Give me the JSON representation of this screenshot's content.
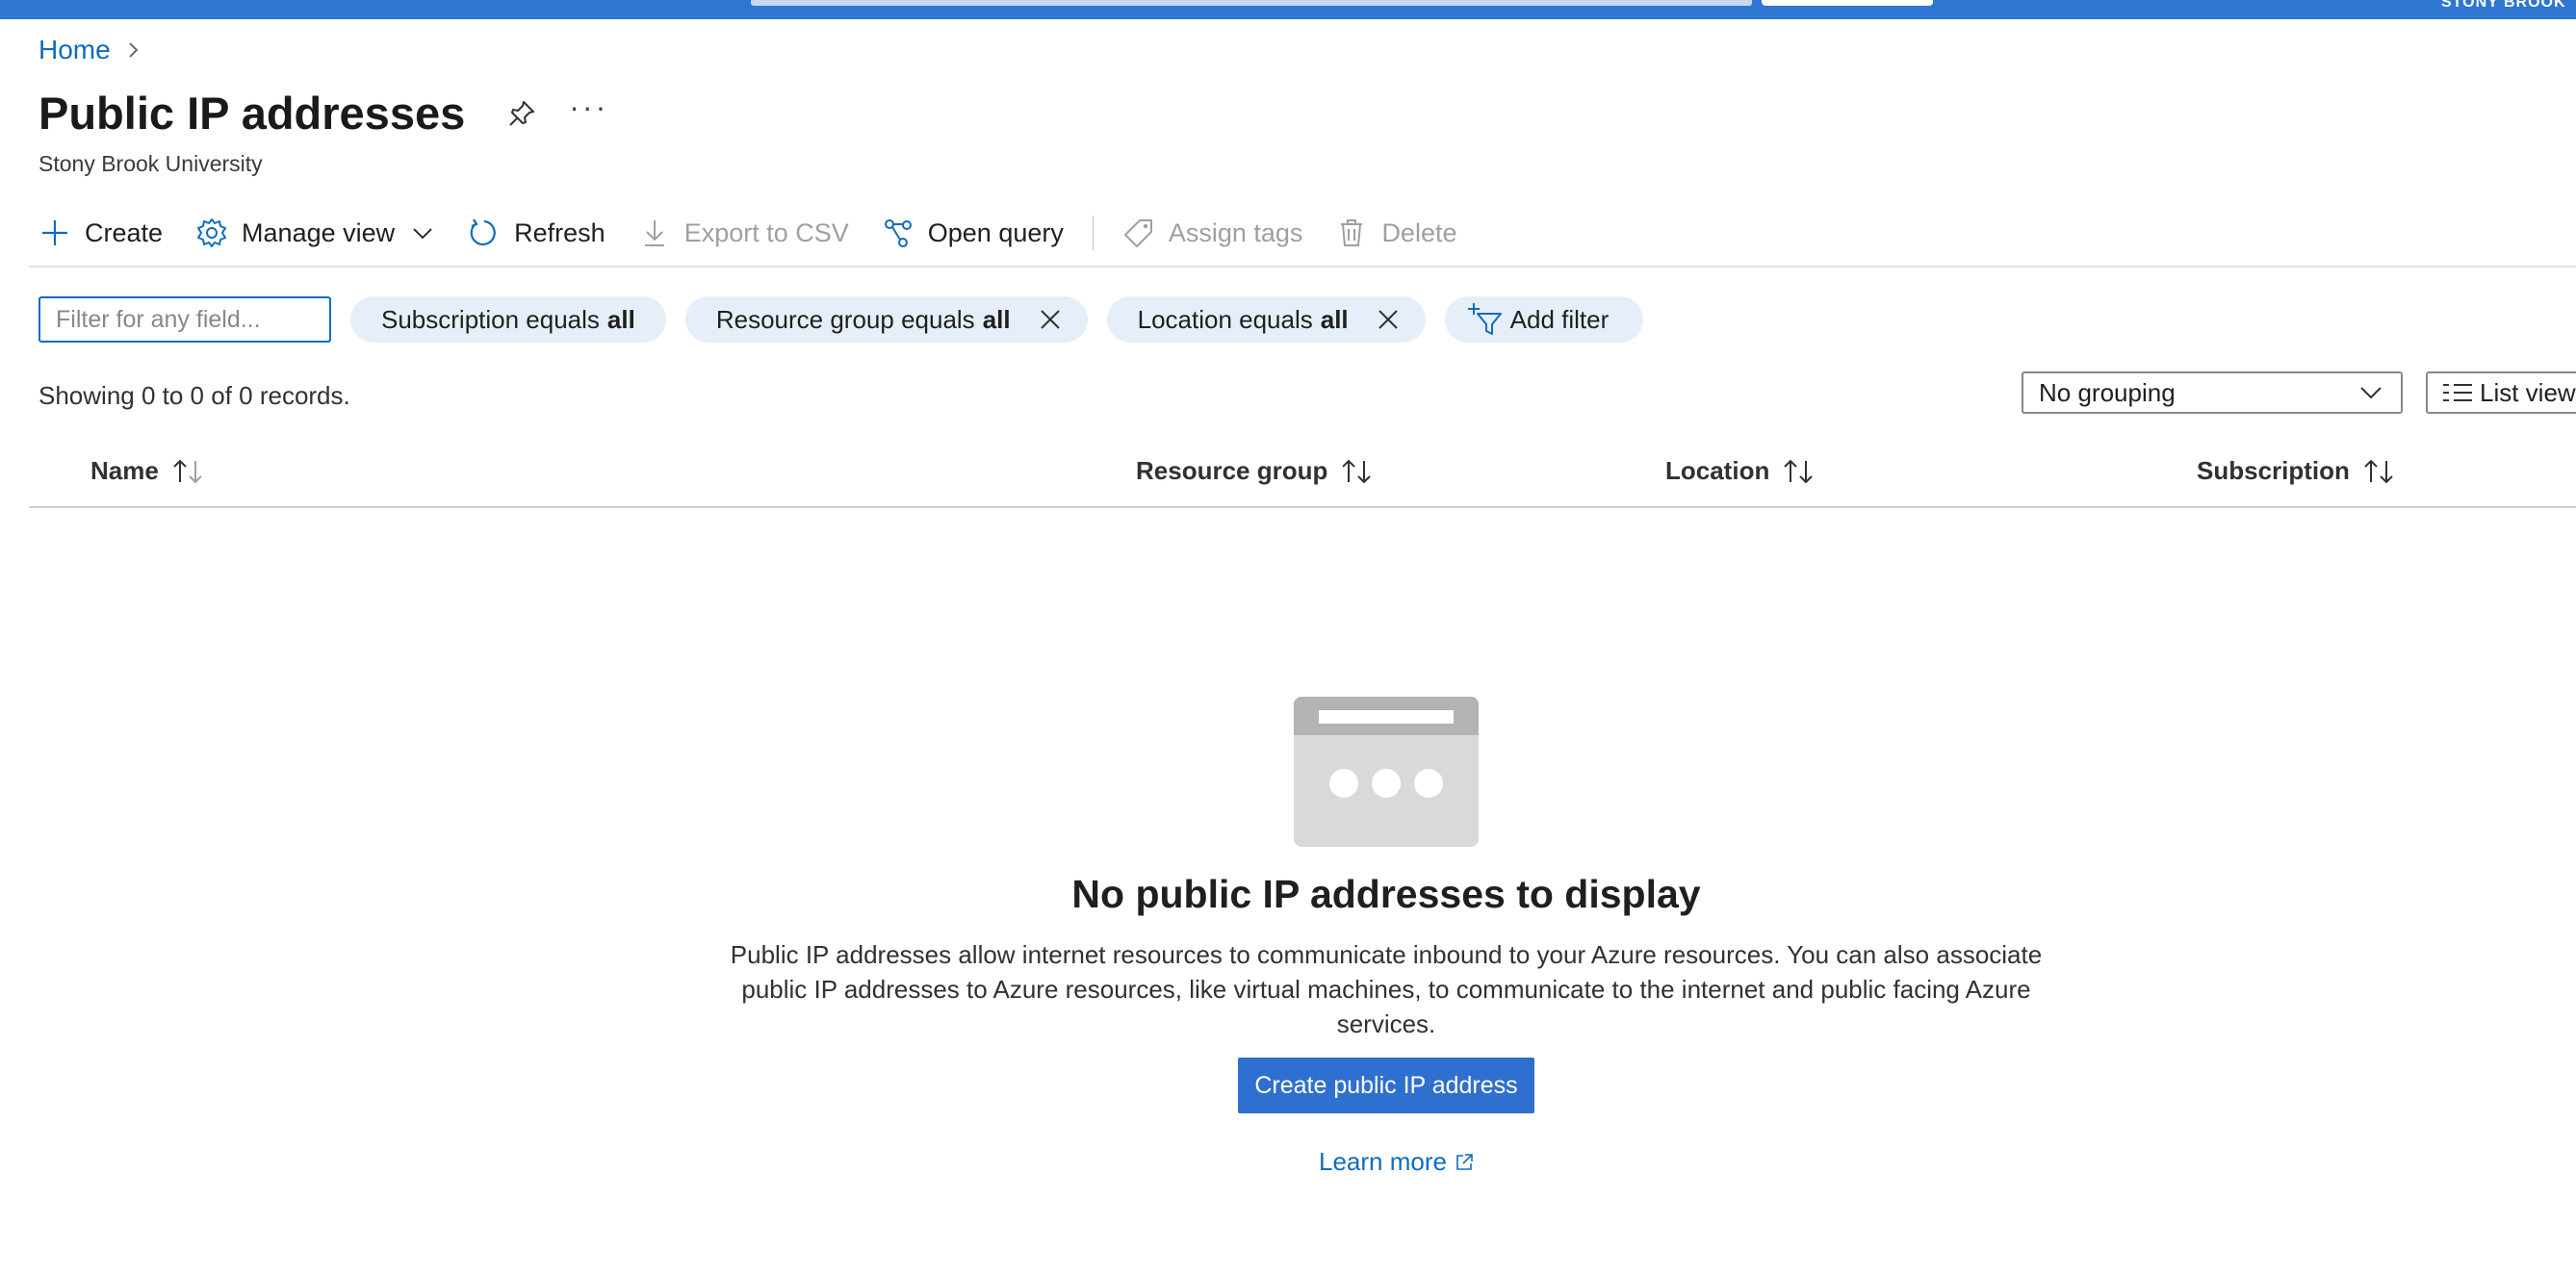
{
  "topbar": {
    "user": "STONY BROOK"
  },
  "breadcrumb": {
    "home": "Home"
  },
  "header": {
    "title": "Public IP addresses",
    "subtitle": "Stony Brook University",
    "more": "···"
  },
  "toolbar": {
    "create": "Create",
    "manage_view": "Manage view",
    "refresh": "Refresh",
    "export_csv": "Export to CSV",
    "open_query": "Open query",
    "assign_tags": "Assign tags",
    "delete": "Delete"
  },
  "filters": {
    "placeholder": "Filter for any field...",
    "pills": [
      {
        "label": "Subscription equals",
        "value": "all"
      },
      {
        "label": "Resource group equals",
        "value": "all"
      },
      {
        "label": "Location equals",
        "value": "all"
      }
    ],
    "add_filter": "Add filter"
  },
  "records": "Showing 0 to 0 of 0 records.",
  "grouping": {
    "selected": "No grouping"
  },
  "view": {
    "label": "List view"
  },
  "table": {
    "columns": [
      "Name",
      "Resource group",
      "Location",
      "Subscription"
    ]
  },
  "empty": {
    "title": "No public IP addresses to display",
    "description": "Public IP addresses allow internet resources to communicate inbound to your Azure resources. You can also associate public IP addresses to Azure resources, like virtual machines, to communicate to the internet and public facing Azure services.",
    "button": "Create public IP address",
    "learn_more": "Learn more"
  },
  "colors": {
    "accent": "#0f6cbd",
    "topbar": "#2f76d2",
    "pill": "#e6eff9",
    "primary_button": "#2f6fcf"
  }
}
